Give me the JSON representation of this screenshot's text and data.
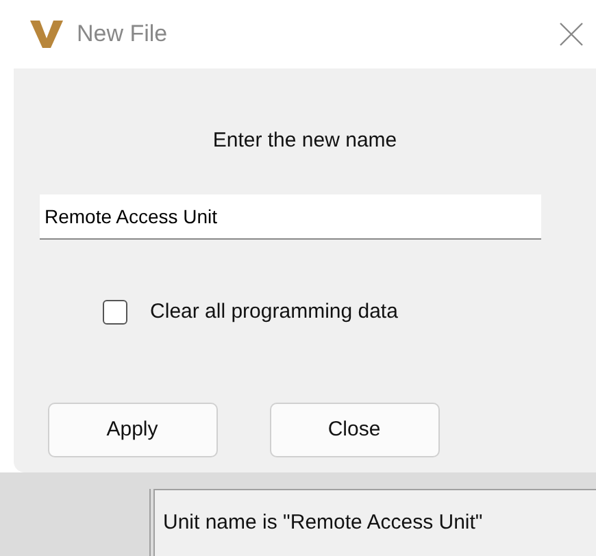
{
  "window": {
    "title": "New File"
  },
  "prompt": "Enter the new name",
  "name_field": {
    "value": "Remote Access Unit"
  },
  "options": [
    {
      "label": "Clear all programming data",
      "checked": false
    }
  ],
  "buttons": [
    "Apply",
    "Close"
  ],
  "status_bar": {
    "text": "Unit name is \"Remote Access Unit\""
  }
}
